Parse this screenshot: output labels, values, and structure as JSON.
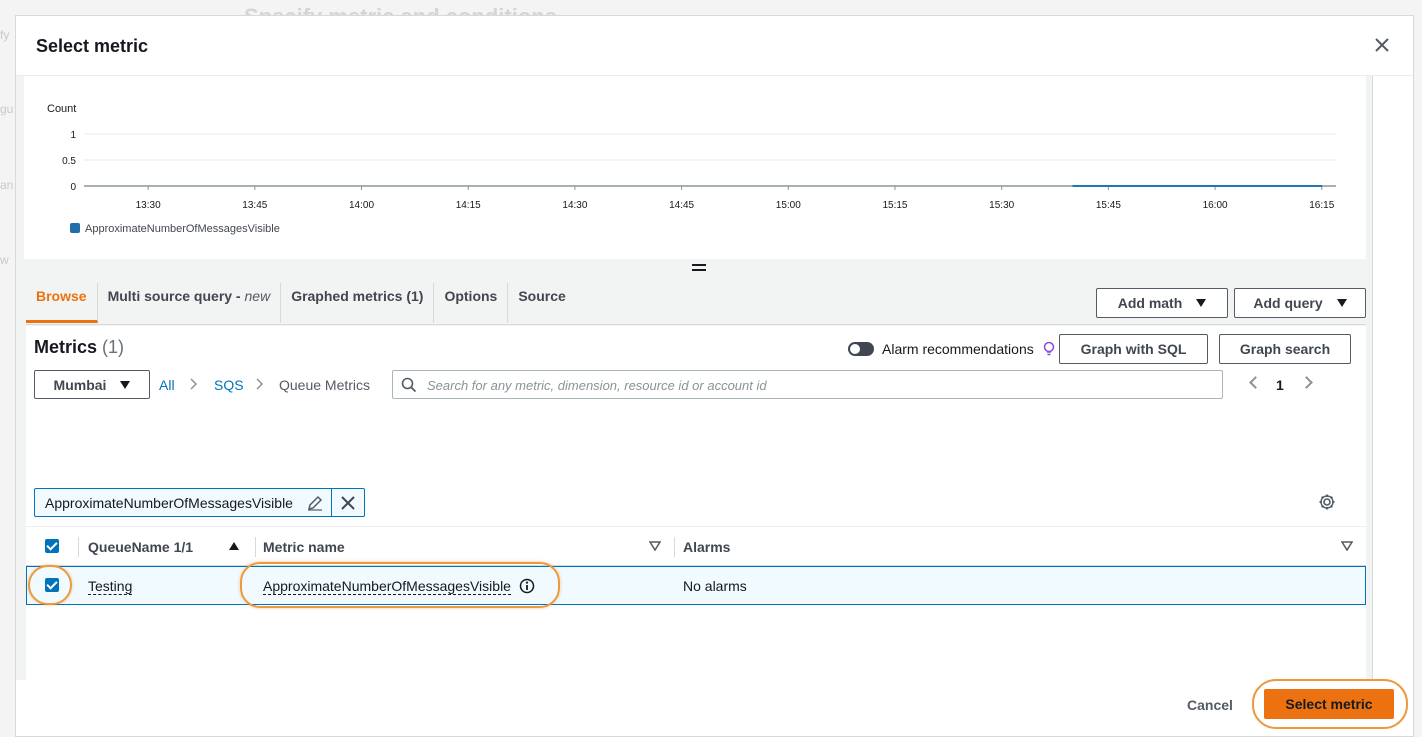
{
  "background": {
    "page_title": "Specify metric and conditions",
    "ghost_texts": [
      "fy",
      "gu",
      "an",
      "w"
    ]
  },
  "modal": {
    "title": "Select metric"
  },
  "chart_data": {
    "type": "line",
    "ylabel": "Count",
    "yticks": [
      "1",
      "0.5",
      "0"
    ],
    "ylim": [
      0,
      1
    ],
    "x_tick_labels": [
      "13:30",
      "13:45",
      "14:00",
      "14:15",
      "14:30",
      "14:45",
      "15:00",
      "15:15",
      "15:30",
      "15:45",
      "16:00",
      "16:15"
    ],
    "grid": true,
    "legend_position": "bottom-left",
    "series": [
      {
        "name": "ApproximateNumberOfMessagesVisible",
        "color": "#1f77b4",
        "x": [
          "15:40",
          "15:45",
          "16:00",
          "16:15"
        ],
        "values": [
          0,
          0,
          0,
          0
        ]
      }
    ]
  },
  "tabs": [
    {
      "label": "Browse",
      "active": true
    },
    {
      "label": "Multi source query - ",
      "badge": "new"
    },
    {
      "label": "Graphed metrics (1)"
    },
    {
      "label": "Options"
    },
    {
      "label": "Source"
    }
  ],
  "actions": {
    "add_math": "Add math",
    "add_query": "Add query",
    "graph_sql": "Graph with SQL",
    "graph_search": "Graph search"
  },
  "metrics": {
    "title": "Metrics",
    "count": "(1)",
    "alarm_recommendations": "Alarm recommendations",
    "region": "Mumbai",
    "breadcrumb": [
      "All",
      "SQS",
      "Queue Metrics"
    ],
    "search_placeholder": "Search for any metric, dimension, resource id or account id",
    "page": "1",
    "filter_token": "ApproximateNumberOfMessagesVisible"
  },
  "table": {
    "columns": [
      "QueueName 1/1",
      "Metric name",
      "Alarms"
    ],
    "rows": [
      {
        "queue": "Testing",
        "metric": "ApproximateNumberOfMessagesVisible",
        "alarms": "No alarms",
        "checked": true
      }
    ]
  },
  "footer": {
    "cancel": "Cancel",
    "select": "Select metric"
  },
  "colors": {
    "accent": "#ec7211",
    "link": "#0073bb",
    "series": "#1f77b4"
  }
}
